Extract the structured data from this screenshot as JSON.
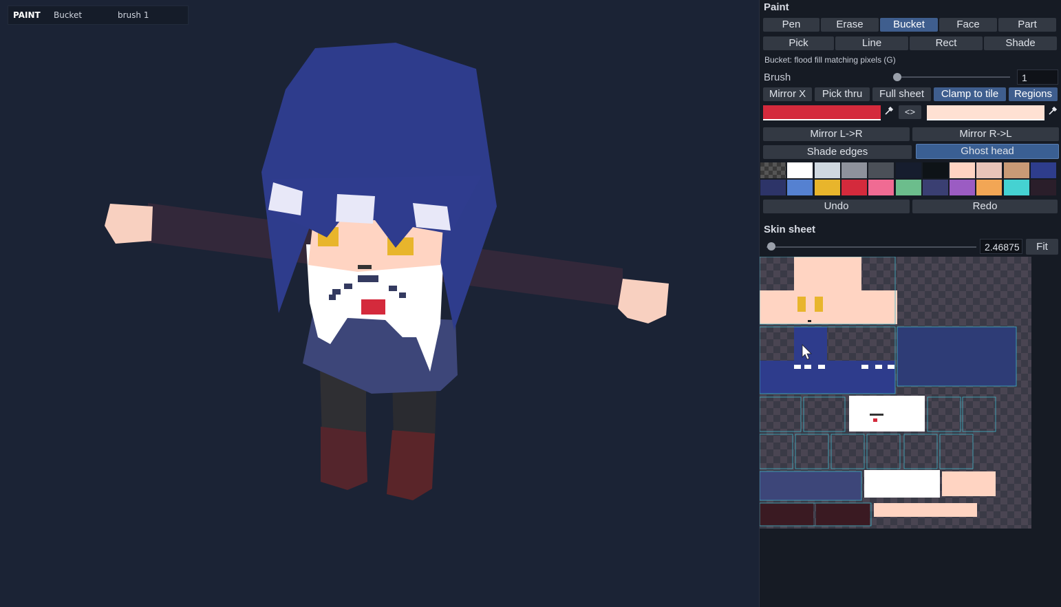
{
  "status": {
    "mode": "PAINT",
    "tool": "Bucket",
    "brush": "brush 1"
  },
  "panel": {
    "title": "Paint",
    "tools_row1": [
      {
        "label": "Pen",
        "active": false
      },
      {
        "label": "Erase",
        "active": false
      },
      {
        "label": "Bucket",
        "active": true
      },
      {
        "label": "Face",
        "active": false
      },
      {
        "label": "Part",
        "active": false
      }
    ],
    "tools_row2": [
      {
        "label": "Pick"
      },
      {
        "label": "Line"
      },
      {
        "label": "Rect"
      },
      {
        "label": "Shade"
      }
    ],
    "hint": "Bucket: flood fill matching pixels (G)",
    "brush_label": "Brush",
    "brush_value": "1",
    "toggles": [
      {
        "label": "Mirror X",
        "active": false
      },
      {
        "label": "Pick thru",
        "active": false
      },
      {
        "label": "Full sheet",
        "active": false
      },
      {
        "label": "Clamp to tile",
        "active": true
      },
      {
        "label": "Regions",
        "active": true
      }
    ],
    "primary_color": "#d42a3c",
    "secondary_color": "#ffe1d3",
    "swap_label": "<>",
    "mirror_lr": "Mirror L->R",
    "mirror_rl": "Mirror R->L",
    "shade_edges": "Shade edges",
    "ghost_head": "Ghost head",
    "palette": [
      "checker",
      "#ffffff",
      "#cfd8e0",
      "#8e929c",
      "#4b5058",
      "#161d2e",
      "#0e1317",
      "#ffd4c2",
      "#e9c4b8",
      "#c99a76",
      "#2e3d8c",
      "#2d3468",
      "#5581d1",
      "#e8b52c",
      "#d42a3c",
      "#f06b93",
      "#6cbd8c",
      "#3a3f72",
      "#9b5cc3",
      "#f2a655",
      "#45d2d2",
      "#2a1e2a"
    ],
    "undo": "Undo",
    "redo": "Redo",
    "skin_title": "Skin sheet",
    "zoom_value": "2.46875",
    "fit": "Fit"
  }
}
